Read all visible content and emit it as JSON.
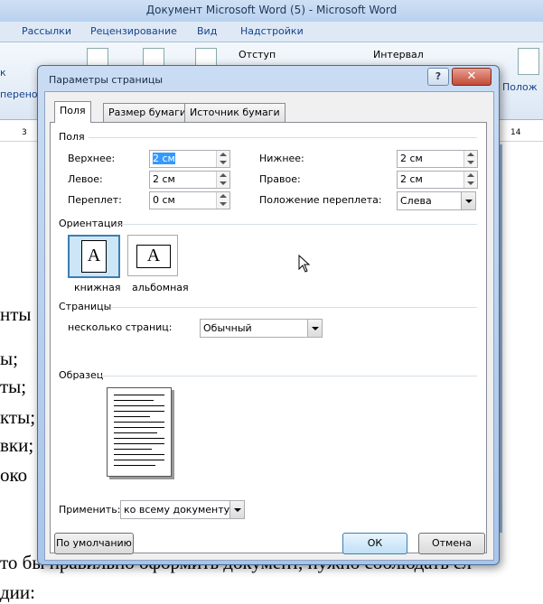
{
  "word": {
    "title": "Документ Microsoft Word (5)  -  Microsoft Word",
    "tabs": [
      "Рассылки",
      "Рецензирование",
      "Вид",
      "Надстройки"
    ],
    "ribbon": {
      "indent_label": "Отступ",
      "interval_label": "Интервал",
      "left_partial": "к",
      "hyphen_partial": "перенос",
      "position_partial": "Полож"
    },
    "ruler": {
      "left_num": "3",
      "right_num": "14"
    },
    "document_lines": [
      "нты",
      "ы;",
      "ты;",
      "кты;",
      "вки;",
      "око",
      "то бы правильно оформить документ, нужно соблюдать сл",
      "дии:"
    ]
  },
  "dialog": {
    "title": "Параметры страницы",
    "help": "?",
    "close": "✕",
    "tabs": [
      "Поля",
      "Размер бумаги",
      "Источник бумаги"
    ],
    "margins_group": "Поля",
    "top_label": "Верхнее:",
    "top_value": "2 см",
    "left_label": "Левое:",
    "left_value": "2 см",
    "gutter_label": "Переплет:",
    "gutter_value": "0 см",
    "bottom_label": "Нижнее:",
    "bottom_value": "2 см",
    "right_label": "Правое:",
    "right_value": "2 см",
    "gutter_pos_label": "Положение переплета:",
    "gutter_pos_value": "Слева",
    "orientation_group": "Ориентация",
    "portrait_label": "книжная",
    "landscape_label": "альбомная",
    "orientation_glyph": "A",
    "pages_group": "Страницы",
    "multiple_pages_label": "несколько страниц:",
    "multiple_pages_value": "Обычный",
    "preview_group": "Образец",
    "apply_label": "Применить:",
    "apply_value": "ко всему документу",
    "default_button": "По умолчанию",
    "ok_button": "ОК",
    "cancel_button": "Отмена"
  }
}
